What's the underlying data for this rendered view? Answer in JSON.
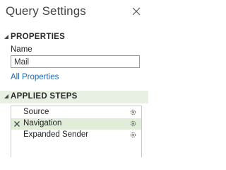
{
  "panel": {
    "title": "Query Settings"
  },
  "properties": {
    "header": "PROPERTIES",
    "name_label": "Name",
    "name_value": "Mail",
    "all_properties_link": "All Properties"
  },
  "applied_steps": {
    "header": "APPLIED STEPS",
    "steps": [
      {
        "label": "Source",
        "selected": false,
        "has_settings": true
      },
      {
        "label": "Navigation",
        "selected": true,
        "has_settings": true
      },
      {
        "label": "Expanded Sender",
        "selected": false,
        "has_settings": true
      }
    ]
  },
  "colors": {
    "link": "#1e66b8",
    "selected_row": "#e1ecd9",
    "section_highlight": "#e8f0e4"
  },
  "icons": [
    "close-icon",
    "collapse-triangle-icon",
    "delete-step-icon",
    "gear-icon"
  ]
}
